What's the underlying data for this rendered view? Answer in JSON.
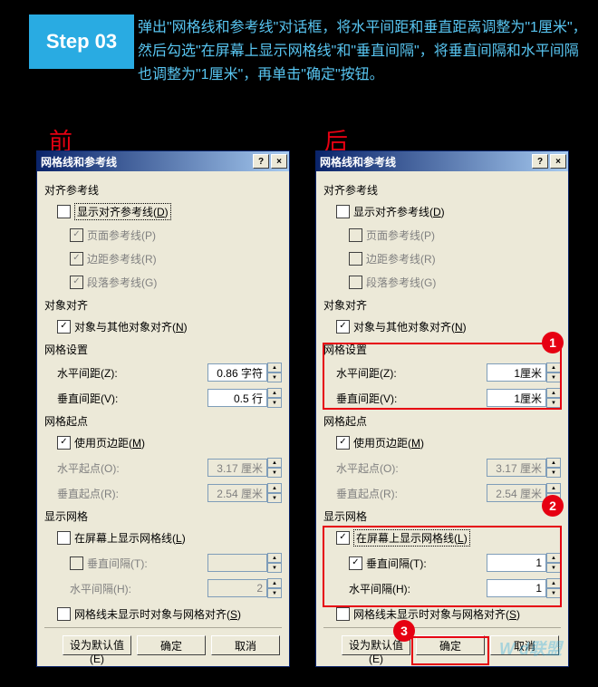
{
  "step": {
    "label": "Step 03"
  },
  "instruction": "弹出\"网格线和参考线\"对话框，将水平间距和垂直距离调整为\"1厘米\"，然后勾选\"在屏幕上显示网格线\"和\"垂直间隔\"，将垂直间隔和水平间隔也调整为\"1厘米\"，再单击\"确定\"按钮。",
  "labels": {
    "before": "前",
    "after": "后"
  },
  "dialog_title": "网格线和参考线",
  "window_buttons": {
    "help": "?",
    "close": "×"
  },
  "sections": {
    "align_guides": "对齐参考线",
    "obj_align": "对象对齐",
    "grid_setting": "网格设置",
    "grid_origin": "网格起点",
    "show_grid": "显示网格"
  },
  "checks": {
    "show_align": {
      "label": "显示对齐参考线(",
      "key": "D",
      "suffix": ")"
    },
    "page_guide": {
      "label": "页面参考线(P)"
    },
    "margin_guide": {
      "label": "边距参考线(R)"
    },
    "para_guide": {
      "label": "段落参考线(G)"
    },
    "snap_others": {
      "label": "对象与其他对象对齐(",
      "key": "N",
      "suffix": ")"
    },
    "use_margin": {
      "label": "使用页边距(",
      "key": "M",
      "suffix": ")"
    },
    "show_grid": {
      "label": "在屏幕上显示网格线(",
      "key": "L",
      "suffix": ")"
    },
    "v_interval": {
      "label": "垂直间隔(",
      "key": "T",
      "suffix": "):"
    },
    "snap_when_hidden": {
      "label": "网格线未显示时对象与网格对齐(",
      "key": "S",
      "suffix": ")"
    }
  },
  "fields": {
    "h_spacing": {
      "label": "水平间距(",
      "key": "Z",
      "suffix": "):"
    },
    "v_spacing": {
      "label": "垂直间距(",
      "key": "V",
      "suffix": "):"
    },
    "h_origin": {
      "label": "水平起点(O):"
    },
    "v_origin": {
      "label": "垂直起点(R):"
    },
    "h_interval": {
      "label": "水平间隔(",
      "key": "H",
      "suffix": "):"
    }
  },
  "left": {
    "h_spacing": "0.86 字符",
    "v_spacing": "0.5 行",
    "h_origin": "3.17 厘米",
    "v_origin": "2.54 厘米",
    "v_interval": "",
    "h_interval": "2"
  },
  "right": {
    "h_spacing": "1厘米",
    "v_spacing": "1厘米",
    "h_origin": "3.17 厘米",
    "v_origin": "2.54 厘米",
    "v_interval": "1",
    "h_interval": "1"
  },
  "buttons": {
    "default": "设为默认值(",
    "default_key": "E",
    "default_suffix": ")",
    "ok": "确定",
    "cancel": "取消"
  },
  "callouts": {
    "c1": "1",
    "c2": "2",
    "c3": "3"
  },
  "watermark": "W   d联盟"
}
